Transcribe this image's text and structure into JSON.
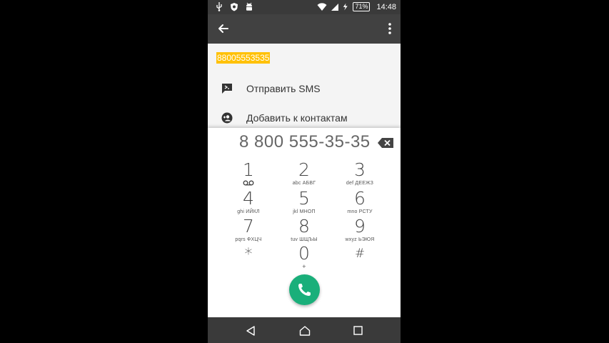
{
  "status_bar": {
    "battery": "71",
    "time": "14:48",
    "left_icons": [
      "usb-icon",
      "shield-icon",
      "android-icon"
    ],
    "right_icons": [
      "wifi-icon",
      "signal-icon",
      "charging-icon"
    ]
  },
  "app_bar": {
    "back_icon": "arrow-back-icon",
    "more_icon": "more-vert-icon"
  },
  "number_display": "88005553535",
  "actions": [
    {
      "label": "Отправить SMS",
      "icon": "sms-icon"
    },
    {
      "label": "Добавить к контактам",
      "icon": "add-contact-icon"
    }
  ],
  "dialpad": {
    "digits": "8 800 555-35-35",
    "keys": [
      {
        "digit": "1",
        "letters": ""
      },
      {
        "digit": "2",
        "letters": "abc АБВГ"
      },
      {
        "digit": "3",
        "letters": "def ДЕЕЖЗ"
      },
      {
        "digit": "4",
        "letters": "ghi ИЙКЛ"
      },
      {
        "digit": "5",
        "letters": "jkl МНОП"
      },
      {
        "digit": "6",
        "letters": "mno РСТУ"
      },
      {
        "digit": "7",
        "letters": "pqrs ФХЦЧ"
      },
      {
        "digit": "8",
        "letters": "tuv ШЩЪЫ"
      },
      {
        "digit": "9",
        "letters": "wxyz ЬЭЮЯ"
      },
      {
        "digit": "*",
        "letters": ""
      },
      {
        "digit": "0",
        "letters": "+"
      },
      {
        "digit": "#",
        "letters": ""
      }
    ]
  },
  "colors": {
    "highlight": "#ffc107",
    "call_button": "#1aaf7a",
    "app_bar": "#414141"
  }
}
